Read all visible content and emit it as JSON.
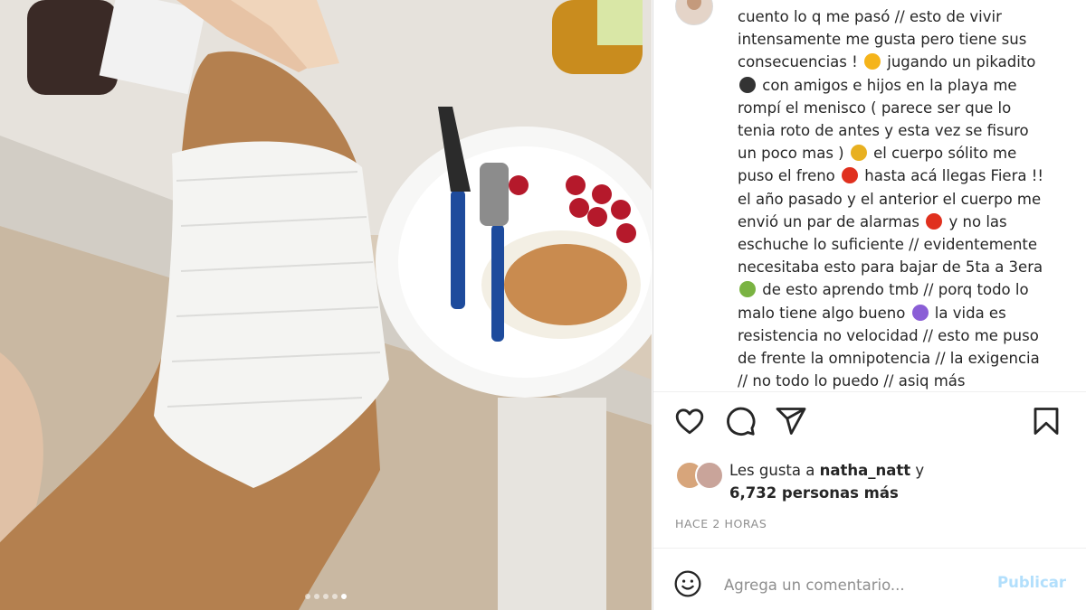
{
  "post": {
    "caption": "cuento lo q me pasó // esto de vivir intensamente me gusta pero tiene sus consecuencias ! 🤪 jugando un pikadito ⚽ con amigos e hijos en la playa me rompí el menisco ( parece ser que lo tenia roto de antes y esta vez se fisuro un poco mas ) 🦵 el cuerpo sólito me puso el freno 🛑 hasta acá llegas Fiera !! el año pasado y el anterior el cuerpo me envió un par de alarmas 🚨 y no las eschuche lo suficiente // evidentemente necesitaba esto para bajar de 5ta a 3era 🧘 de esto aprendo tmb // porq todo lo malo tiene algo bueno ☯ la vida es resistencia no velocidad // esto me puso de frente la omnipotencia // la exigencia // no todo lo puedo // asiq más",
    "caption_lines": [
      "cuento lo q me pasó // esto de vivir",
      "intensamente me gusta pero tiene sus",
      "consecuencias ! [e1] jugando un pikadito",
      "[e2] con amigos e hijos en la playa me",
      "rompí el menisco ( parece ser que lo",
      "tenia roto de antes y esta vez se fisuro",
      "un poco mas ) [e3] el cuerpo sólito me",
      "puso el freno [e4] hasta acá llegas Fiera !!",
      "el año pasado y el anterior el cuerpo me",
      "envió un par de alarmas [e5] y no las",
      "eschuche lo suficiente // evidentemente",
      "necesitaba esto para bajar de 5ta a 3era",
      "[e6] de esto aprendo tmb // porq todo lo",
      "malo tiene algo bueno [e7] la vida es",
      "resistencia no velocidad // esto me puso",
      "de frente la omnipotencia // la exigencia",
      "// no todo lo puedo // asiq más"
    ],
    "emojis": [
      {
        "id": "e1",
        "name": "zany-face-emoji",
        "glyph": "🤪",
        "color": "#f5b41a"
      },
      {
        "id": "e2",
        "name": "soccer-ball-emoji",
        "glyph": "⚽",
        "color": "#333333"
      },
      {
        "id": "e3",
        "name": "leg-emoji",
        "glyph": "🦵",
        "color": "#e8b020"
      },
      {
        "id": "e4",
        "name": "stop-sign-emoji",
        "glyph": "🛑",
        "color": "#e0301e"
      },
      {
        "id": "e5",
        "name": "siren-emoji",
        "glyph": "🚨",
        "color": "#e0301e"
      },
      {
        "id": "e6",
        "name": "meditation-emoji",
        "glyph": "🧘",
        "color": "#7ab342"
      },
      {
        "id": "e7",
        "name": "yin-yang-emoji",
        "glyph": "☯",
        "color": "#8a5ed6"
      }
    ],
    "likes": {
      "prefix": "Les gusta a ",
      "user": "natha_natt",
      "connector": " y",
      "count_text": "6,732 personas más"
    },
    "time": "HACE 2 HORAS",
    "comment": {
      "placeholder": "Agrega un comentario...",
      "publish_label": "Publicar"
    },
    "carousel": {
      "count": 5,
      "active_index": 4
    }
  },
  "icons": [
    "heart-icon",
    "comment-icon",
    "share-icon",
    "bookmark-icon",
    "emoji-smile-icon"
  ],
  "colors": {
    "text": "#262626",
    "muted": "#8e8e8e",
    "publish_disabled": "#b2dffc",
    "border": "#dbdbdb"
  }
}
